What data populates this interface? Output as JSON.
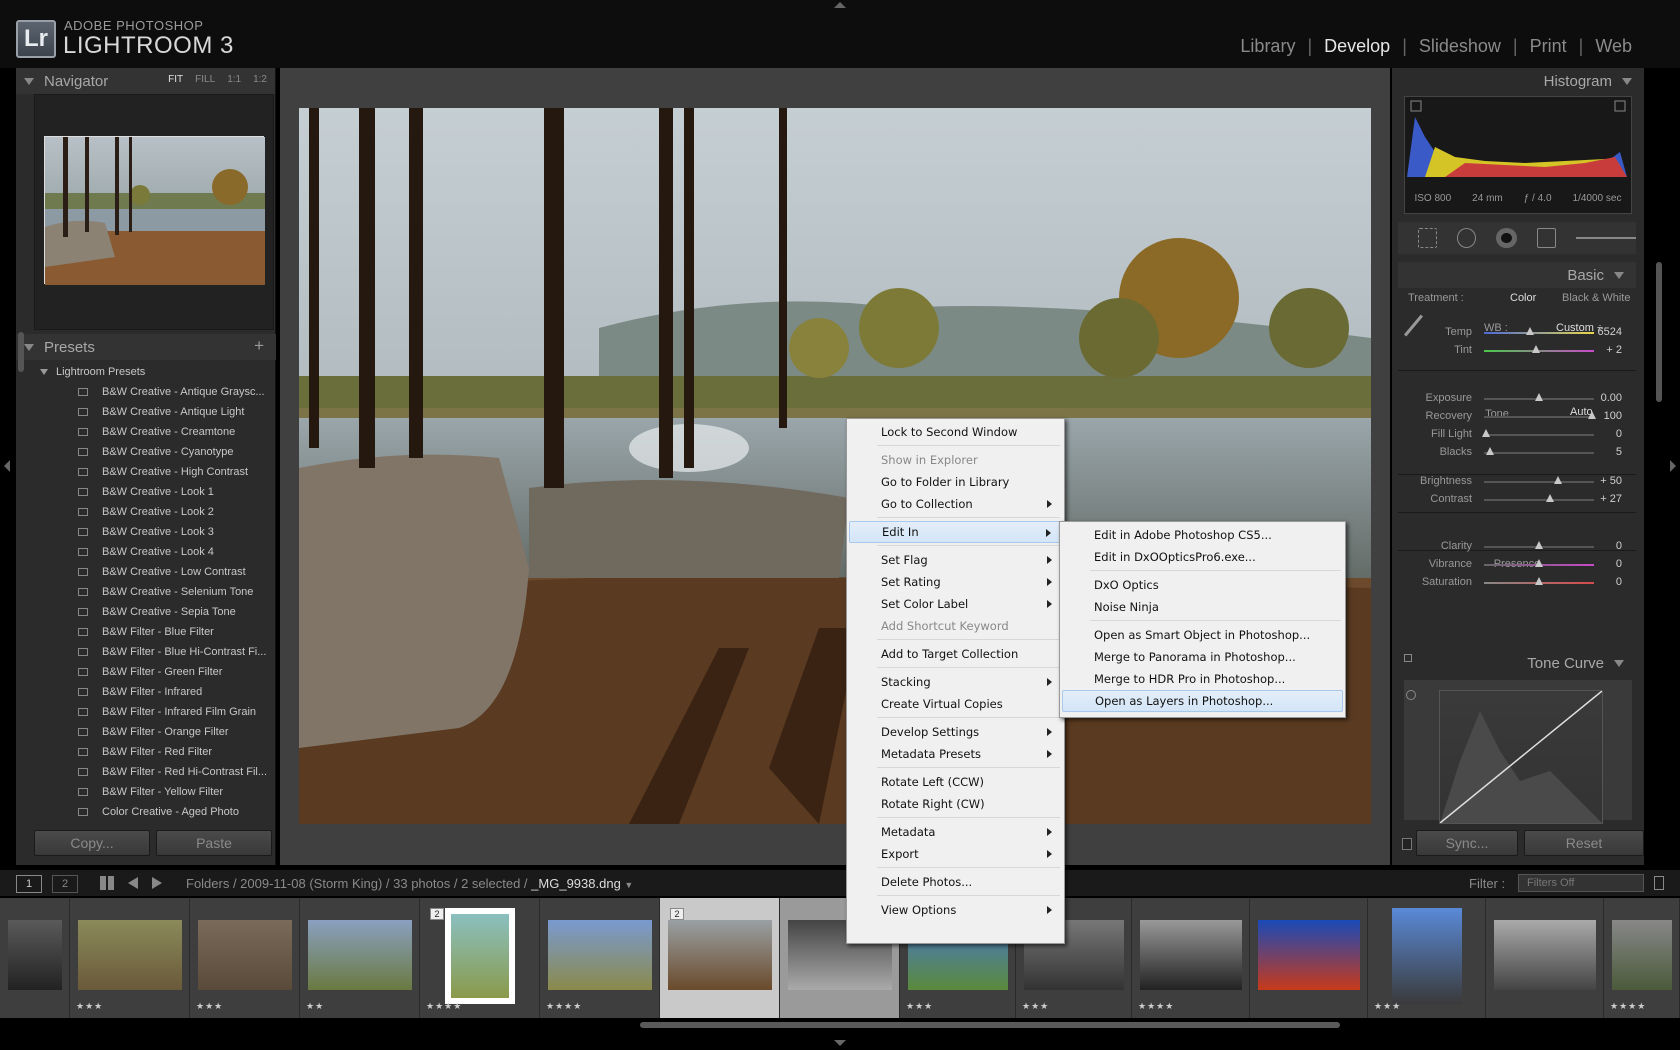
{
  "app": {
    "brand_top": "ADOBE PHOTOSHOP",
    "brand_main": "LIGHTROOM 3",
    "logo": "Lr"
  },
  "modules": [
    {
      "label": "Library",
      "active": false
    },
    {
      "label": "Develop",
      "active": true
    },
    {
      "label": "Slideshow",
      "active": false
    },
    {
      "label": "Print",
      "active": false
    },
    {
      "label": "Web",
      "active": false
    }
  ],
  "navigator": {
    "title": "Navigator",
    "options": [
      "FIT",
      "FILL",
      "1:1",
      "1:2"
    ]
  },
  "presets": {
    "title": "Presets",
    "add": "+",
    "folder": "Lightroom Presets",
    "items": [
      "B&W Creative - Antique Graysc...",
      "B&W Creative - Antique Light",
      "B&W Creative - Creamtone",
      "B&W Creative - Cyanotype",
      "B&W Creative - High Contrast",
      "B&W Creative - Look 1",
      "B&W Creative - Look 2",
      "B&W Creative - Look 3",
      "B&W Creative - Look 4",
      "B&W Creative - Low Contrast",
      "B&W Creative - Selenium Tone",
      "B&W Creative - Sepia Tone",
      "B&W Filter - Blue Filter",
      "B&W Filter - Blue Hi-Contrast Fi...",
      "B&W Filter - Green Filter",
      "B&W Filter - Infrared",
      "B&W Filter - Infrared Film Grain",
      "B&W Filter - Orange Filter",
      "B&W Filter - Red Filter",
      "B&W Filter - Red Hi-Contrast Fil...",
      "B&W Filter - Yellow Filter",
      "Color Creative - Aged Photo"
    ]
  },
  "left_buttons": {
    "copy": "Copy...",
    "paste": "Paste"
  },
  "histogram": {
    "title": "Histogram",
    "iso": "ISO 800",
    "focal": "24 mm",
    "aperture": "ƒ / 4.0",
    "shutter": "1/4000 sec"
  },
  "basic": {
    "title": "Basic",
    "treatment_label": "Treatment :",
    "treatment_color": "Color",
    "treatment_bw": "Black & White",
    "wb_label": "WB :",
    "wb_value": "Custom ÷",
    "tone_label": "Tone",
    "auto": "Auto",
    "presence_label": "Presence",
    "sliders": [
      {
        "label": "Temp",
        "value": "6524",
        "pos": 0.42
      },
      {
        "label": "Tint",
        "value": "+ 2",
        "pos": 0.47
      },
      {
        "label": "Exposure",
        "value": "0.00",
        "pos": 0.5
      },
      {
        "label": "Recovery",
        "value": "100",
        "pos": 0.98
      },
      {
        "label": "Fill Light",
        "value": "0",
        "pos": 0.02
      },
      {
        "label": "Blacks",
        "value": "5",
        "pos": 0.05
      },
      {
        "label": "Brightness",
        "value": "+ 50",
        "pos": 0.67
      },
      {
        "label": "Contrast",
        "value": "+ 27",
        "pos": 0.6
      },
      {
        "label": "Clarity",
        "value": "0",
        "pos": 0.5
      },
      {
        "label": "Vibrance",
        "value": "0",
        "pos": 0.5
      },
      {
        "label": "Saturation",
        "value": "0",
        "pos": 0.5
      }
    ]
  },
  "tonecurve": {
    "title": "Tone Curve"
  },
  "right_buttons": {
    "sync": "Sync...",
    "reset": "Reset"
  },
  "filmbar": {
    "screen1": "1",
    "screen2": "2",
    "path": "Folders / 2009-11-08 (Storm King) / 33 photos / 2 selected / ",
    "file": "_MG_9938.dng",
    "filter_label": "Filter :",
    "filter_value": "Filters Off"
  },
  "filmstrip": [
    {
      "stars": "",
      "badge": ""
    },
    {
      "stars": "★★★",
      "badge": ""
    },
    {
      "stars": "★★★",
      "badge": ""
    },
    {
      "stars": "★★",
      "badge": ""
    },
    {
      "stars": "★★★★",
      "badge": "2"
    },
    {
      "stars": "★★★★",
      "badge": ""
    },
    {
      "stars": "",
      "badge": "2"
    },
    {
      "stars": "",
      "badge": ""
    },
    {
      "stars": "★★★",
      "badge": ""
    },
    {
      "stars": "★★★",
      "badge": ""
    },
    {
      "stars": "★★★★",
      "badge": ""
    },
    {
      "stars": "",
      "badge": ""
    },
    {
      "stars": "★★★",
      "badge": ""
    },
    {
      "stars": "",
      "badge": ""
    },
    {
      "stars": "★★★★",
      "badge": ""
    }
  ],
  "context_menu": [
    {
      "label": "Lock to Second Window",
      "disabled": false,
      "sub": false
    },
    {
      "label": "Show in Explorer",
      "disabled": true,
      "sub": false
    },
    {
      "label": "Go to Folder in Library",
      "disabled": false,
      "sub": false
    },
    {
      "label": "Go to Collection",
      "disabled": false,
      "sub": true
    },
    {
      "label": "Edit In",
      "disabled": false,
      "sub": true,
      "highlight": true
    },
    {
      "label": "Set Flag",
      "disabled": false,
      "sub": true
    },
    {
      "label": "Set Rating",
      "disabled": false,
      "sub": true
    },
    {
      "label": "Set Color Label",
      "disabled": false,
      "sub": true
    },
    {
      "label": "Add Shortcut Keyword",
      "disabled": true,
      "sub": false
    },
    {
      "label": "Add to Target Collection",
      "disabled": false,
      "sub": false
    },
    {
      "label": "Stacking",
      "disabled": false,
      "sub": true
    },
    {
      "label": "Create Virtual Copies",
      "disabled": false,
      "sub": false
    },
    {
      "label": "Develop Settings",
      "disabled": false,
      "sub": true
    },
    {
      "label": "Metadata Presets",
      "disabled": false,
      "sub": true
    },
    {
      "label": "Rotate Left (CCW)",
      "disabled": false,
      "sub": false
    },
    {
      "label": "Rotate Right (CW)",
      "disabled": false,
      "sub": false
    },
    {
      "label": "Metadata",
      "disabled": false,
      "sub": true
    },
    {
      "label": "Export",
      "disabled": false,
      "sub": true
    },
    {
      "label": "Delete Photos...",
      "disabled": false,
      "sub": false
    },
    {
      "label": "View Options",
      "disabled": false,
      "sub": true
    }
  ],
  "edit_in_menu": [
    {
      "label": "Edit in Adobe Photoshop CS5..."
    },
    {
      "label": "Edit in DxOOpticsPro6.exe..."
    },
    {
      "label": "DxO Optics"
    },
    {
      "label": "Noise Ninja"
    },
    {
      "label": "Open as Smart Object in Photoshop..."
    },
    {
      "label": "Merge to Panorama in Photoshop..."
    },
    {
      "label": "Merge to HDR Pro in Photoshop..."
    },
    {
      "label": "Open as Layers in Photoshop...",
      "highlight": true
    }
  ]
}
